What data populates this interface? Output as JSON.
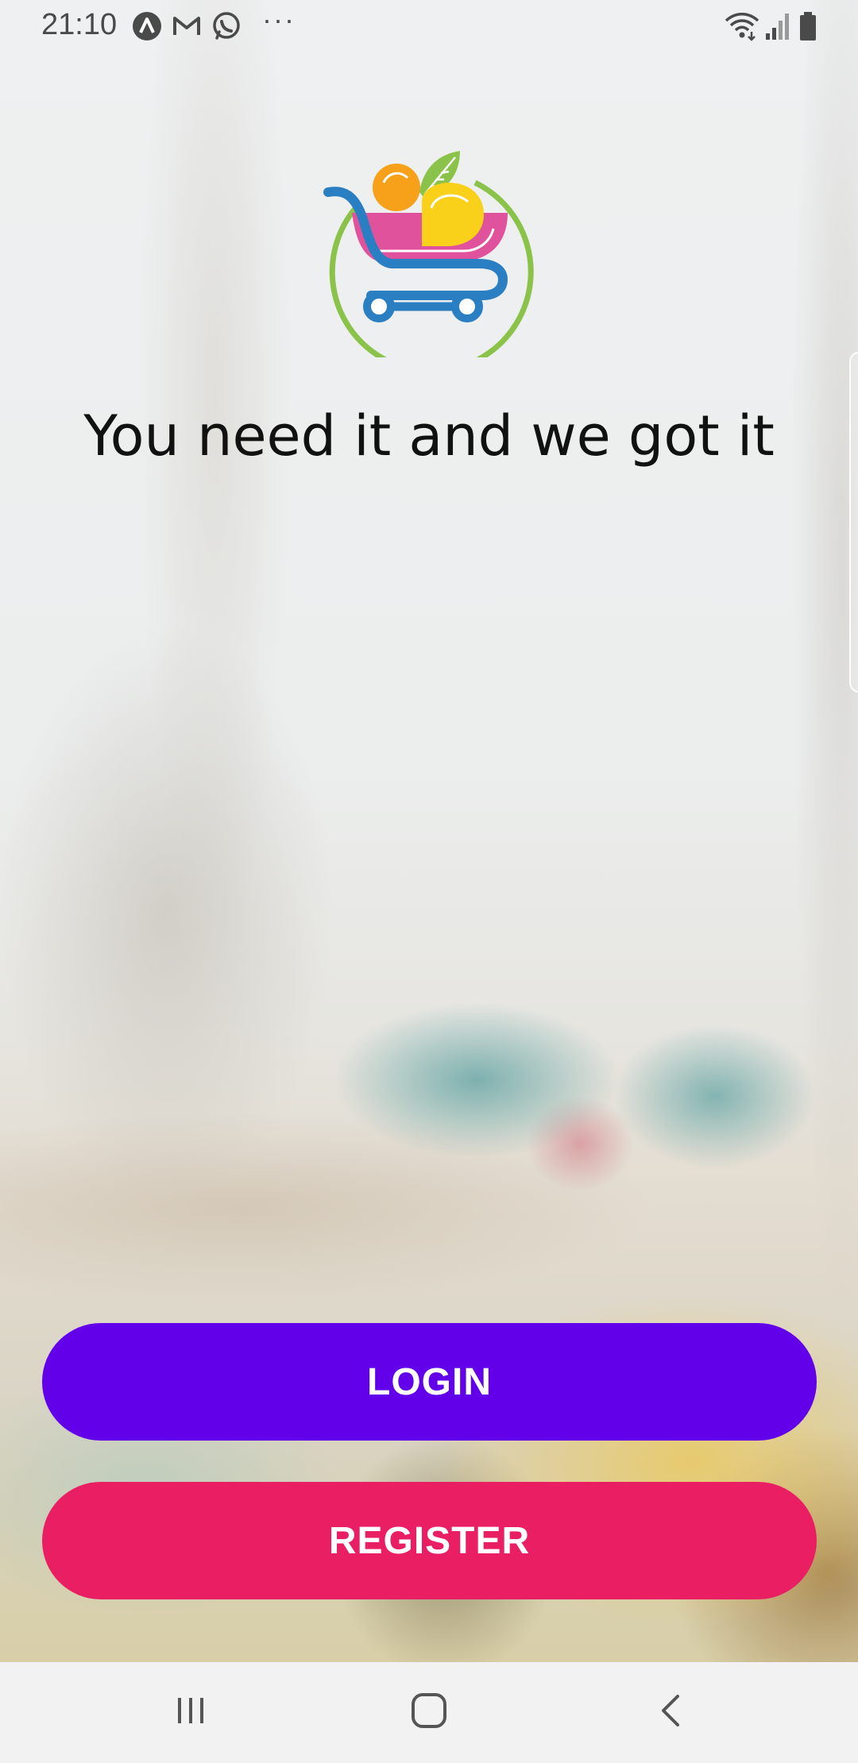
{
  "status_bar": {
    "time": "21:10",
    "notification_icons": [
      "arc-icon",
      "gmail-icon",
      "whatsapp-icon"
    ],
    "more_indicator": "···",
    "right_icons": [
      "wifi-icon",
      "signal-icon",
      "battery-icon"
    ]
  },
  "app": {
    "logo_icon": "shopping-cart-logo-icon",
    "tagline": "You need it and we got it",
    "login_label": "LOGIN",
    "register_label": "REGISTER"
  },
  "colors": {
    "login": "#6200ea",
    "register": "#e91e63",
    "logo_green": "#8bc34a",
    "logo_blue": "#2a7fc2",
    "logo_pink": "#e0529c",
    "logo_orange": "#f7a11a",
    "logo_yellow": "#f9d11a"
  },
  "nav_bar": {
    "items": [
      "recent-apps-icon",
      "home-icon",
      "back-icon"
    ]
  }
}
